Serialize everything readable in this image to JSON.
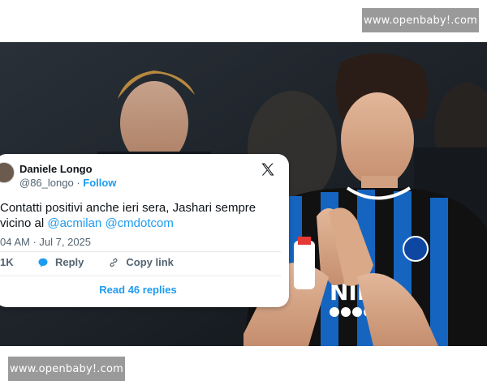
{
  "watermark": {
    "top": "www.openbaby!.com",
    "bottom": "www.openbaby!.com"
  },
  "tweet": {
    "author_name": "Daniele Longo",
    "handle": "@86_longo",
    "separator": " · ",
    "follow_label": "Follow",
    "text_line1": "Contatti positivi anche ieri sera, Jashari sempre",
    "text_line2_prefix": "vicino al ",
    "mention_1": "@acmilan",
    "mention_2": "@cmdotcom",
    "timestamp": "04 AM · Jul 7, 2025",
    "likes": "1K",
    "reply_label": "Reply",
    "copy_link_label": "Copy link",
    "read_replies_label": "Read 46 replies"
  },
  "photo": {
    "jersey_sponsor": "UNIBET",
    "jersey_sponsor_short": "NIBE"
  },
  "colors": {
    "accent": "#1d9bf0",
    "text": "#0f1419",
    "muted": "#536471",
    "jersey_blue": "#1565c0"
  },
  "icons": [
    "x-logo-icon",
    "reply-bubble-icon",
    "link-icon"
  ]
}
